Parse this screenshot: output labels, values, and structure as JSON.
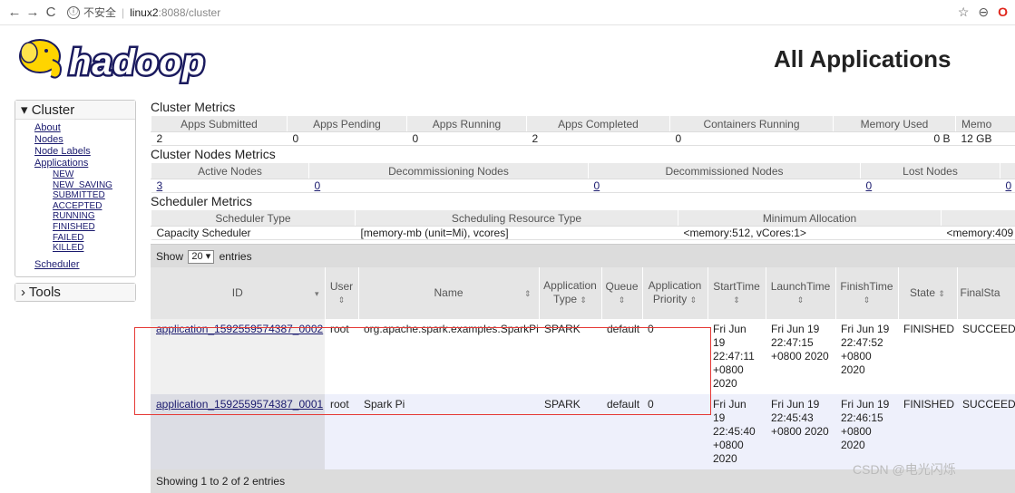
{
  "browser": {
    "back": "←",
    "forward": "→",
    "reload": "C",
    "info_icon": "ⓘ",
    "security": "不安全",
    "host": "linux2",
    "path": ":8088/cluster",
    "star": "☆",
    "account": "⊖",
    "opera": "O"
  },
  "logo_text": "hadoop",
  "page_title": "All Applications",
  "sidebar": {
    "cluster": {
      "title": "Cluster",
      "arrow": "▾"
    },
    "links": [
      "About",
      "Nodes",
      "Node Labels",
      "Applications"
    ],
    "app_states": [
      "NEW",
      "NEW_SAVING",
      "SUBMITTED",
      "ACCEPTED",
      "RUNNING",
      "FINISHED",
      "FAILED",
      "KILLED"
    ],
    "scheduler": "Scheduler",
    "tools": {
      "title": "Tools",
      "arrow": "›"
    }
  },
  "cluster_metrics": {
    "title": "Cluster Metrics",
    "headers": [
      "Apps Submitted",
      "Apps Pending",
      "Apps Running",
      "Apps Completed",
      "Containers Running",
      "Memory Used",
      "Memo"
    ],
    "values": [
      "2",
      "0",
      "0",
      "2",
      "0",
      "0 B",
      "12 GB"
    ]
  },
  "nodes_metrics": {
    "title": "Cluster Nodes Metrics",
    "headers": [
      "Active Nodes",
      "Decommissioning Nodes",
      "Decommissioned Nodes",
      "Lost Nodes",
      ""
    ],
    "values": [
      "3",
      "0",
      "0",
      "0",
      "0"
    ]
  },
  "scheduler_metrics": {
    "title": "Scheduler Metrics",
    "headers": [
      "Scheduler Type",
      "Scheduling Resource Type",
      "Minimum Allocation",
      ""
    ],
    "values": [
      "Capacity Scheduler",
      "[memory-mb (unit=Mi), vcores]",
      "<memory:512, vCores:1>",
      "<memory:409"
    ]
  },
  "apps_table": {
    "show_prefix": "Show",
    "show_value": "20",
    "show_suffix": "entries",
    "columns": [
      "ID",
      "User",
      "Name",
      "Application Type",
      "Queue",
      "Application Priority",
      "StartTime",
      "LaunchTime",
      "FinishTime",
      "State",
      "FinalSta"
    ],
    "sort_icon": "⇕",
    "sort_desc_icon": "▾",
    "rows": [
      {
        "id": "application_1592559574387_0002",
        "user": "root",
        "name": "org.apache.spark.examples.SparkPi",
        "type": "SPARK",
        "queue": "default",
        "priority": "0",
        "start": "Fri Jun 19 22:47:11 +0800 2020",
        "launch": "Fri Jun 19 22:47:15 +0800 2020",
        "finish": "Fri Jun 19 22:47:52 +0800 2020",
        "state": "FINISHED",
        "final": "SUCCEED"
      },
      {
        "id": "application_1592559574387_0001",
        "user": "root",
        "name": "Spark Pi",
        "type": "SPARK",
        "queue": "default",
        "priority": "0",
        "start": "Fri Jun 19 22:45:40 +0800 2020",
        "launch": "Fri Jun 19 22:45:43 +0800 2020",
        "finish": "Fri Jun 19 22:46:15 +0800 2020",
        "state": "FINISHED",
        "final": "SUCCEED"
      }
    ],
    "footer": "Showing 1 to 2 of 2 entries"
  },
  "watermark": "CSDN @电光闪烁"
}
